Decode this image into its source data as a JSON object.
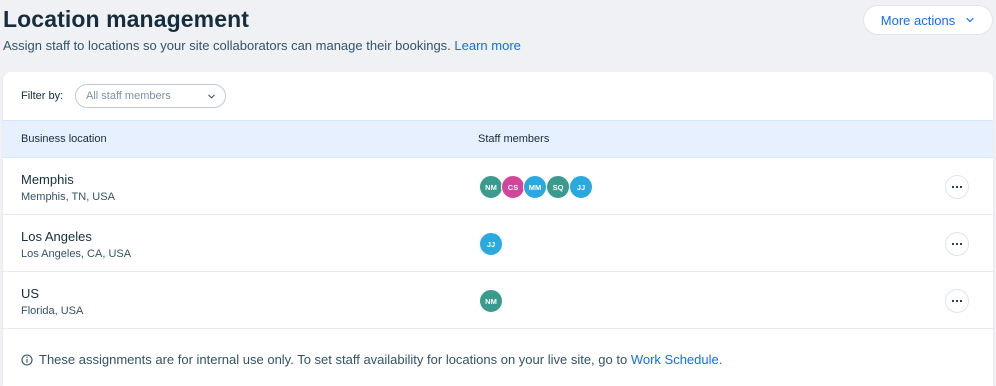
{
  "header": {
    "title": "Location management",
    "subtitle": "Assign staff to locations so your site collaborators can manage their bookings.",
    "learn_more": "Learn more",
    "more_actions": "More actions"
  },
  "filter": {
    "label": "Filter by:",
    "value": "All staff members"
  },
  "table": {
    "headers": {
      "location": "Business location",
      "staff": "Staff members"
    },
    "rows": [
      {
        "name": "Memphis",
        "address": "Memphis, TN, USA",
        "staff": [
          {
            "initials": "NM",
            "color": "#3a9a8e"
          },
          {
            "initials": "CS",
            "color": "#d2459a"
          },
          {
            "initials": "MM",
            "color": "#2aa9e0"
          },
          {
            "initials": "SQ",
            "color": "#3a9a8e"
          },
          {
            "initials": "JJ",
            "color": "#2aa9e0"
          }
        ]
      },
      {
        "name": "Los Angeles",
        "address": "Los Angeles, CA, USA",
        "staff": [
          {
            "initials": "JJ",
            "color": "#2aa9e0"
          }
        ]
      },
      {
        "name": "US",
        "address": "Florida, USA",
        "staff": [
          {
            "initials": "NM",
            "color": "#3a9a8e"
          }
        ]
      }
    ]
  },
  "footer": {
    "note": "These assignments are for internal use only. To set staff availability for locations on your live site, go to",
    "link": "Work Schedule."
  },
  "colors": {
    "accent": "#116dff",
    "header_row_bg": "#e7f0ff",
    "page_bg": "#f0f1f4"
  },
  "icons": {
    "more_actions_chevron": "chevron-down-icon",
    "filter_chevron": "chevron-down-icon",
    "row_menu": "more-horizontal-icon",
    "footer_info": "info-icon"
  }
}
